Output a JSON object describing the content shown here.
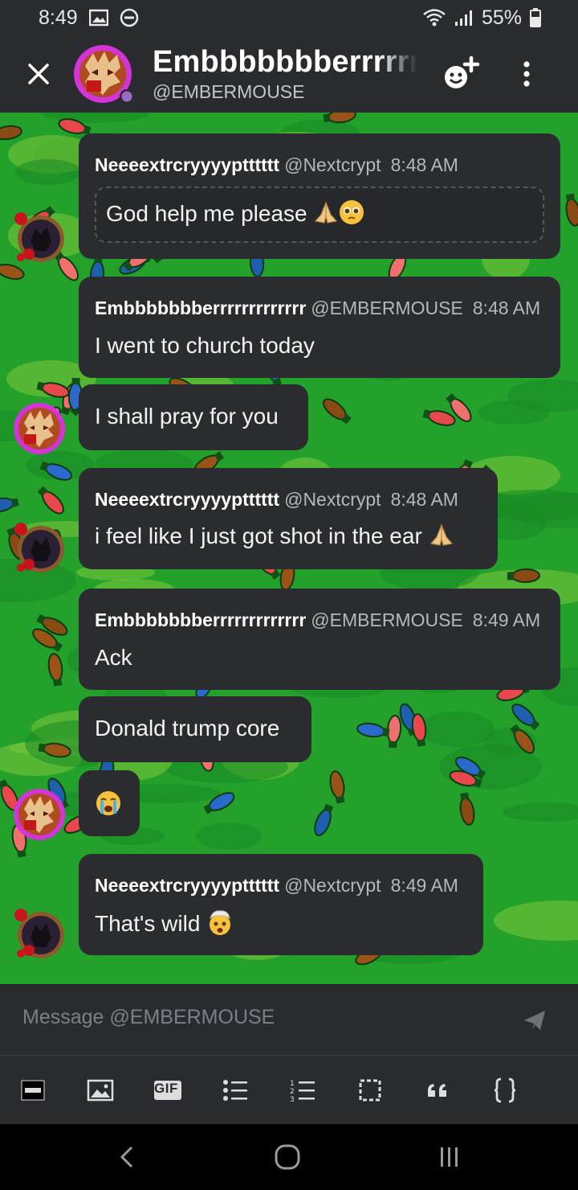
{
  "status_bar": {
    "time": "8:49",
    "battery": "55%"
  },
  "header": {
    "display_name": "Embbbbbbberrrrrrrrrrrrr",
    "handle": "@EMBERMOUSE",
    "icons": [
      "close-icon",
      "add-user-icon",
      "more-vertical-icon"
    ]
  },
  "messages": [
    {
      "author": "Neeeextrcryyyyptttttt",
      "handle": "@Nextcrypt",
      "time": "8:48 AM",
      "text": "God help me please"
    },
    {
      "author": "Embbbbbbberrrrrrrrrrrrr",
      "handle": "@EMBERMOUSE",
      "time": "8:48 AM",
      "text": "I went to church today"
    },
    {
      "text": "I shall pray for you"
    },
    {
      "author": "Neeeextrcryyyyptttttt",
      "handle": "@Nextcrypt",
      "time": "8:48 AM",
      "text": "i feel like I just got shot in the ear"
    },
    {
      "author": "Embbbbbbberrrrrrrrrrrrr",
      "handle": "@EMBERMOUSE",
      "time": "8:49 AM",
      "text": "Ack"
    },
    {
      "text": "Donald trump core"
    },
    {
      "text": ""
    },
    {
      "author": "Neeeextrcryyyyptttttt",
      "handle": "@Nextcrypt",
      "time": "8:49 AM",
      "text": "That's wild"
    }
  ],
  "composer": {
    "placeholder": "Message @EMBERMOUSE"
  },
  "toolbar": {
    "icons": [
      "spoiler-icon",
      "image-icon",
      "gif-icon",
      "bulleted-list-icon",
      "numbered-list-icon",
      "code-block-icon",
      "quote-icon",
      "braces-icon"
    ],
    "gif_label": "GIF"
  },
  "colors": {
    "background_green": "#23a12a",
    "bubble": "#2b2c2f",
    "header": "#2a2b2e"
  }
}
